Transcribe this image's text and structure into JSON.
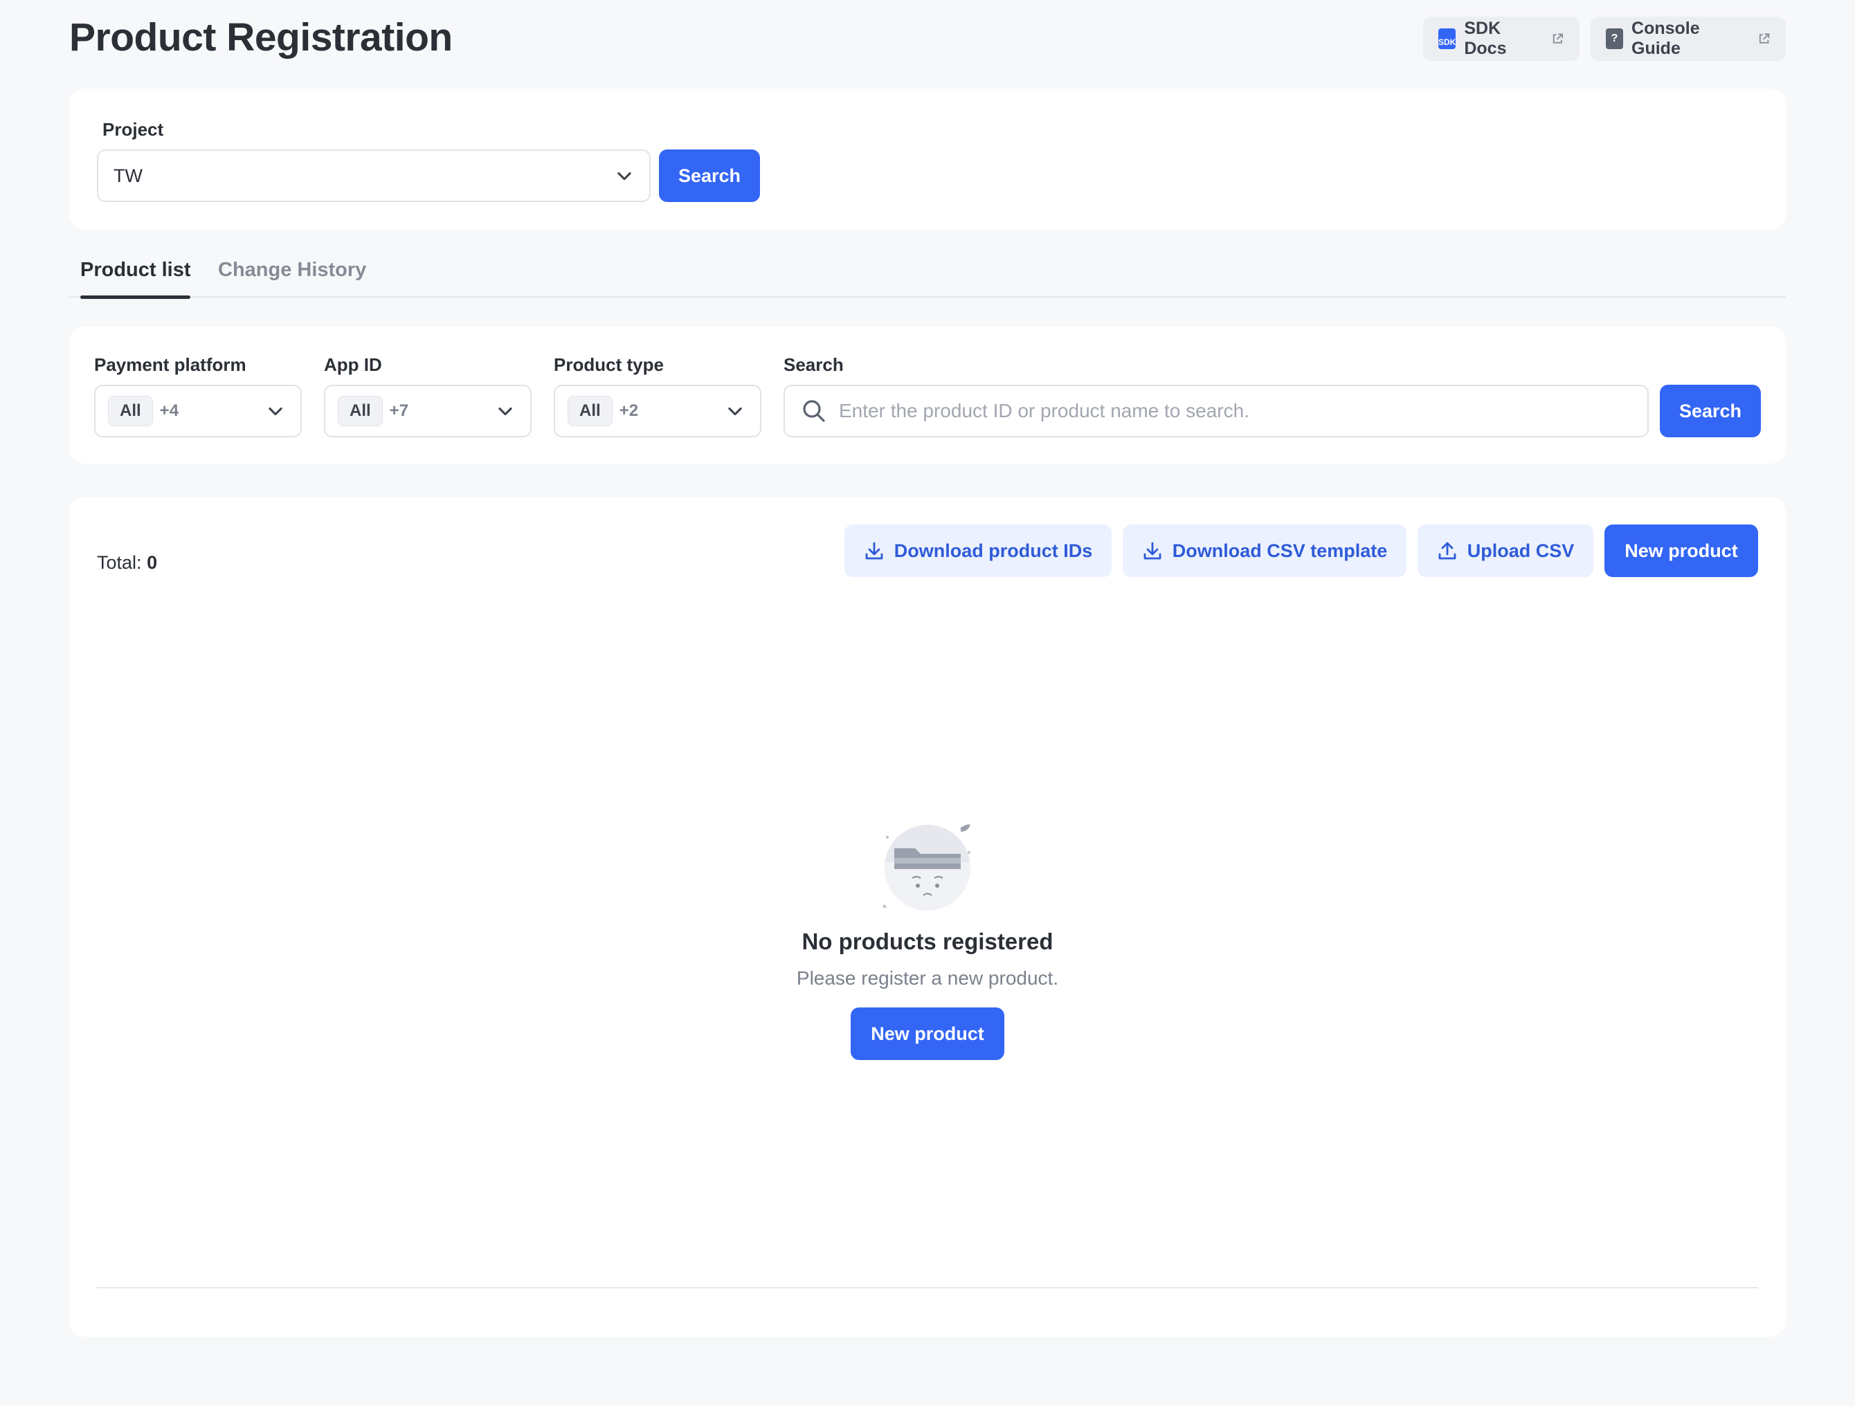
{
  "header": {
    "title": "Product Registration",
    "sdk_docs_label": "SDK Docs",
    "sdk_badge": "SDK",
    "console_guide_label": "Console Guide",
    "console_badge": "?"
  },
  "project_filter": {
    "label": "Project",
    "selected": "TW",
    "search_label": "Search"
  },
  "tabs": [
    {
      "label": "Product list",
      "active": true
    },
    {
      "label": "Change History",
      "active": false
    }
  ],
  "filters": {
    "payment_platform": {
      "label": "Payment platform",
      "chip": "All",
      "more": "+4"
    },
    "app_id": {
      "label": "App ID",
      "chip": "All",
      "more": "+7"
    },
    "product_type": {
      "label": "Product type",
      "chip": "All",
      "more": "+2"
    },
    "search": {
      "label": "Search",
      "placeholder": "Enter the product ID or product name to search.",
      "button_label": "Search"
    }
  },
  "list": {
    "total_label": "Total:",
    "total_value": "0",
    "download_ids_label": "Download product IDs",
    "download_template_label": "Download CSV template",
    "upload_csv_label": "Upload CSV",
    "new_product_label": "New product"
  },
  "empty_state": {
    "title": "No products registered",
    "subtitle": "Please register a new product.",
    "button_label": "New product"
  },
  "colors": {
    "primary": "#3366f5",
    "soft_button": "#ebf1fe",
    "background": "#f7f8fa"
  }
}
